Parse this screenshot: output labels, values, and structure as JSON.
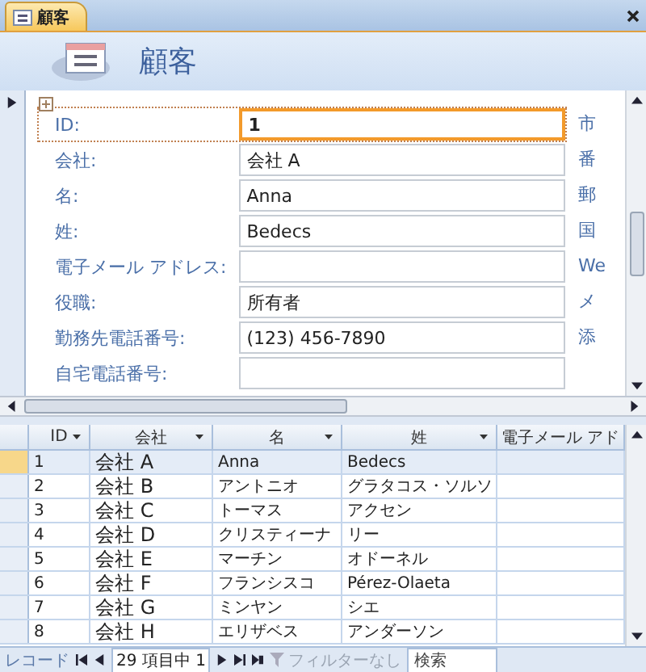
{
  "tab": {
    "label": "顧客",
    "selected": true
  },
  "header": {
    "title": "顧客"
  },
  "form": {
    "fields": [
      {
        "label": "ID:",
        "value": "1",
        "focused": true
      },
      {
        "label": "会社:",
        "value": "会社 A",
        "focused": false
      },
      {
        "label": "名:",
        "value": "Anna",
        "focused": false
      },
      {
        "label": "姓:",
        "value": "Bedecs",
        "focused": false
      },
      {
        "label": "電子メール アドレス:",
        "focused": false
      },
      {
        "label": "役職:",
        "value": "所有者",
        "focused": false
      },
      {
        "label": "勤務先電話番号:",
        "value": "(123) 456-7890",
        "focused": false
      },
      {
        "label": "自宅電話番号:",
        "focused": false
      }
    ],
    "side_labels": [
      "市",
      "番",
      "郵",
      "国",
      "We",
      "メ",
      "添"
    ]
  },
  "datasheet": {
    "columns": [
      "ID",
      "会社",
      "名",
      "姓",
      "電子メール アド"
    ],
    "rows": [
      {
        "selected": true,
        "cells": [
          "1",
          "会社 A",
          "Anna",
          "Bedecs"
        ]
      },
      {
        "selected": false,
        "cells": [
          "2",
          "会社 B",
          "アントニオ",
          "グラタコス・ソルソ"
        ]
      },
      {
        "selected": false,
        "cells": [
          "3",
          "会社 C",
          "トーマス",
          "アクセン"
        ]
      },
      {
        "selected": false,
        "cells": [
          "4",
          "会社 D",
          "クリスティーナ",
          "リー"
        ]
      },
      {
        "selected": false,
        "cells": [
          "5",
          "会社 E",
          "マーチン",
          "オドーネル"
        ]
      },
      {
        "selected": false,
        "cells": [
          "6",
          "会社 F",
          "フランシスコ",
          "Pérez-Olaeta"
        ]
      },
      {
        "selected": false,
        "cells": [
          "7",
          "会社 G",
          "ミンヤン",
          "シエ"
        ]
      },
      {
        "selected": false,
        "cells": [
          "8",
          "会社 H",
          "エリザベス",
          "アンダーソン"
        ]
      }
    ]
  },
  "nav": {
    "label": "レコード",
    "position": "29 項目中 1",
    "filter": "フィルターなし",
    "search": "検索"
  }
}
